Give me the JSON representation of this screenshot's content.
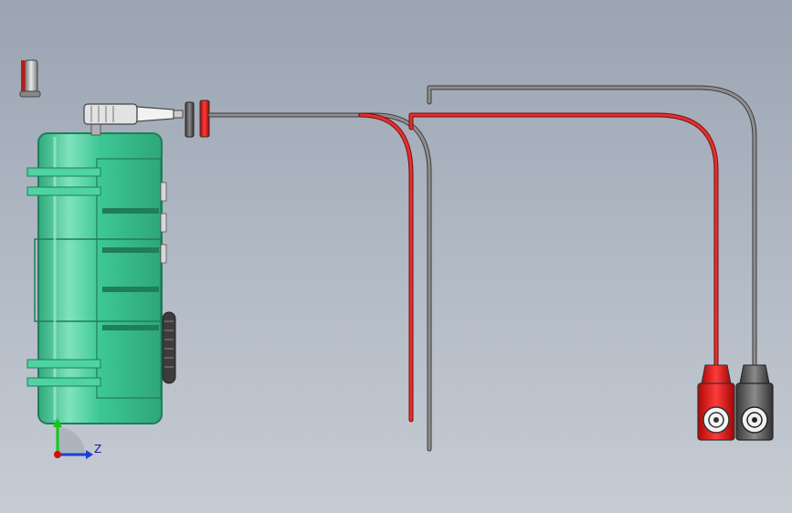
{
  "viewport": {
    "background_top": "#9aa4b2",
    "background_bottom": "#c7ccd4"
  },
  "colors": {
    "housing_green": "#3dc795",
    "housing_dark": "#1f7d5a",
    "wire_red": "#d62525",
    "wire_gray": "#6e6e6e",
    "clip_red": "#e01010",
    "clip_gray": "#555555",
    "axis_y": "#12c812",
    "axis_z": "#1a3fd6",
    "axis_origin": "#d01010"
  },
  "icons": {
    "pin": "pin-part-icon",
    "triad": "coordinate-triad-icon"
  },
  "triad": {
    "z_label": "Z"
  }
}
